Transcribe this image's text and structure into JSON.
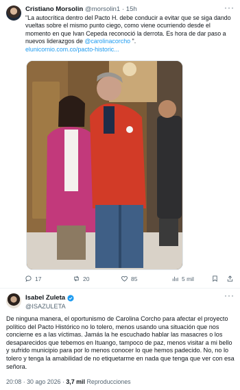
{
  "quoted_tweet": {
    "author_name": "Cristiano Morsolin",
    "author_handle": "@morsolin1",
    "time": "15h",
    "text_before_mention": "\"La autocrítica dentro del Pacto H. debe conducir a evitar que se siga dando vueltas sobre el mismo punto ciego, como viene ocurriendo desde el momento en que Ivan Cepeda reconoció la derrota. Es hora de dar paso a nuevos liderazgos de ",
    "mention": "@carolinacorcho",
    "text_after_mention": " \".",
    "link": "elunicornio.com.co/pacto-historic...",
    "photo_icon": "photo-two-people",
    "actions": {
      "replies": "17",
      "reposts": "20",
      "likes": "85",
      "views": "5 mil"
    },
    "icons": [
      "reply-icon",
      "repost-icon",
      "like-icon",
      "views-icon",
      "bookmark-icon",
      "share-icon"
    ]
  },
  "main_tweet": {
    "author_name": "Isabel Zuleta",
    "author_handle": "@ISAZULETA",
    "text": "De ninguna manera, el oportunismo de Carolina Corcho para afectar el proyecto político del Pacto Histórico no lo tolero, menos usando una situación que nos concierne es a las víctimas. Jamás la he escuchado hablar las masacres o los desaparecidos  que tebemos en Ituango, tampoco de paz, menos visitar a mi bello y sufrido municipio para por lo menos conocer lo que hemos padecido. No, no lo tolero y tenga la amabilidad de no etiquetarme en nada que tenga que ver con esa señora.",
    "time": "20:08",
    "date": "30 ago 2026",
    "views_count": "3,7 mil",
    "views_label": "Reproducciones"
  },
  "colors": {
    "link": "#1d9bf0",
    "secondary_text": "#536471",
    "verified_badge": "#1d9bf0"
  }
}
